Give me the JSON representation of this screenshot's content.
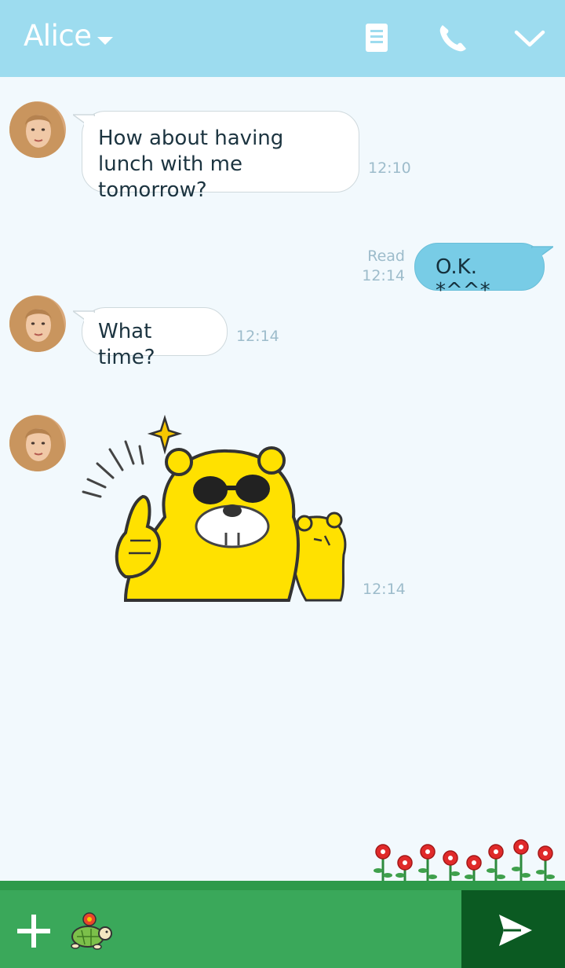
{
  "header": {
    "title": "Alice",
    "icons": [
      "caret-down-icon",
      "notes-icon",
      "phone-icon",
      "chevron-down-icon"
    ],
    "background": "#9ddcef"
  },
  "messages": [
    {
      "direction": "incoming",
      "text": "How about having lunch with me tomorrow?",
      "time": "12:10"
    },
    {
      "direction": "outgoing",
      "text": "O.K. *^^*",
      "status": "Read",
      "time": "12:14"
    },
    {
      "direction": "incoming",
      "text": "What time?",
      "time": "12:14"
    },
    {
      "direction": "incoming",
      "type": "sticker",
      "sticker": "yellow-bear-sunglasses-thumbs-up",
      "time": "12:14"
    }
  ],
  "input_bar": {
    "icons": [
      "plus-icon",
      "turtle-sticker-icon",
      "send-icon"
    ],
    "bar_color": "#3aa85a",
    "send_color": "#0b5a22"
  },
  "colors": {
    "chat_background": "#f2f9fd",
    "outgoing_bubble": "#78cce6",
    "incoming_bubble": "#ffffff",
    "timestamp": "#9dbccb"
  }
}
